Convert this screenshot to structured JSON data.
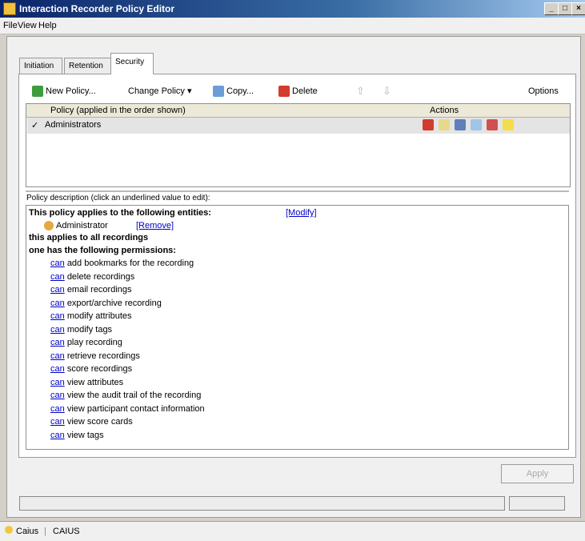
{
  "window": {
    "title": "Interaction Recorder Policy Editor"
  },
  "menu": [
    "File",
    "View",
    "Help"
  ],
  "tabs": [
    "Initiation",
    "Retention",
    "Security"
  ],
  "toolbar": {
    "new_policy": "New Policy...",
    "change_policy": "Change Policy",
    "copy": "Copy...",
    "delete": "Delete",
    "options": "Options"
  },
  "grid": {
    "col_policy": "Policy (applied in the order shown)",
    "col_actions": "Actions",
    "rows": [
      {
        "checked": "✓",
        "name": "Administrators"
      }
    ]
  },
  "description": {
    "label": "Policy description (click an underlined value to edit):",
    "applies_to": "This policy applies to the following entities:",
    "modify": "[Modify]",
    "entity": "Administrator",
    "remove": "[Remove]",
    "all_recordings": "this applies to all recordings",
    "has_perms": "one has the following permissions:",
    "can": "can",
    "permissions": [
      "add bookmarks for the recording",
      "delete recordings",
      "email recordings",
      "export/archive recording",
      "modify attributes",
      "modify tags",
      "play recording",
      "retrieve recordings",
      "score recordings",
      "view attributes",
      "view the audit trail of the recording",
      "view participant contact information",
      "view score cards",
      "view tags"
    ]
  },
  "apply_button": "Apply",
  "status": {
    "user": "Caius",
    "machine": "CAIUS"
  },
  "colors": {
    "title_bar": "#0a246a",
    "link": "#0000cc",
    "row_highlight": "#e4e4e4"
  }
}
